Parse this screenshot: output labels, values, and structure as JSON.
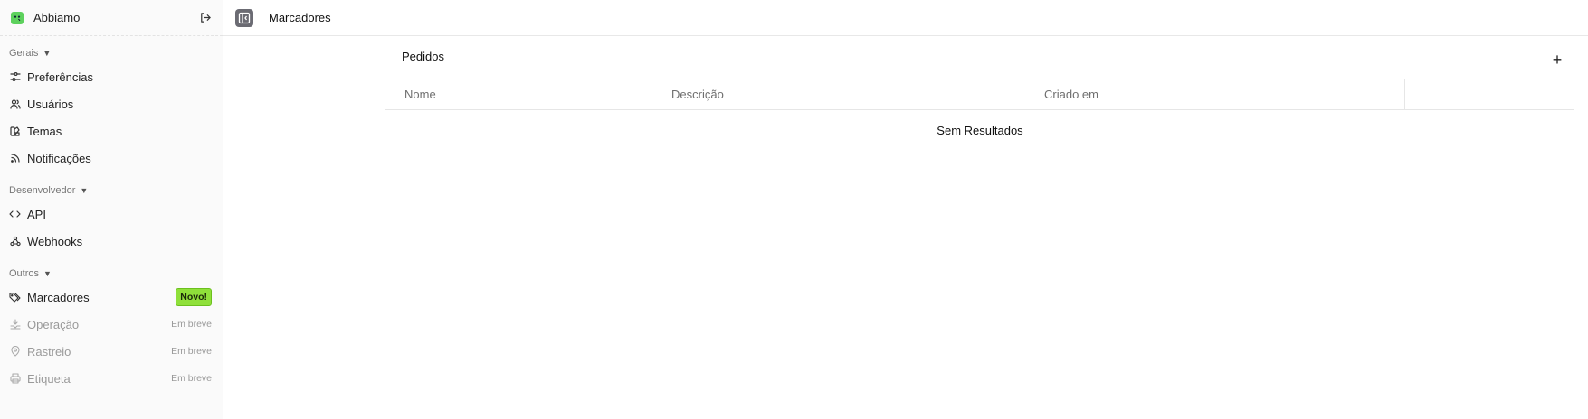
{
  "app": {
    "brand": "Abbiamo",
    "accent": "#5dd15d"
  },
  "sidebar": {
    "groups": [
      {
        "label": "Gerais",
        "items": [
          {
            "label": "Preferências",
            "icon": "sliders-icon"
          },
          {
            "label": "Usuários",
            "icon": "users-icon"
          },
          {
            "label": "Temas",
            "icon": "palette-icon"
          },
          {
            "label": "Notificações",
            "icon": "rss-icon"
          }
        ]
      },
      {
        "label": "Desenvolvedor",
        "items": [
          {
            "label": "API",
            "icon": "code-icon"
          },
          {
            "label": "Webhooks",
            "icon": "webhook-icon"
          }
        ]
      },
      {
        "label": "Outros",
        "items": [
          {
            "label": "Marcadores",
            "icon": "tags-icon",
            "badge": "Novo!"
          },
          {
            "label": "Operação",
            "icon": "operation-icon",
            "status": "Em breve"
          },
          {
            "label": "Rastreio",
            "icon": "map-pin-icon",
            "status": "Em breve"
          },
          {
            "label": "Etiqueta",
            "icon": "printer-icon",
            "status": "Em breve"
          }
        ]
      }
    ]
  },
  "topbar": {
    "title": "Marcadores"
  },
  "section": {
    "title": "Pedidos",
    "add_label": "+",
    "columns": [
      "Nome",
      "Descrição",
      "Criado em",
      ""
    ],
    "empty_text": "Sem Resultados"
  },
  "colors": {
    "badge_new": "#8fe03a",
    "muted": "#9a9a9a"
  }
}
